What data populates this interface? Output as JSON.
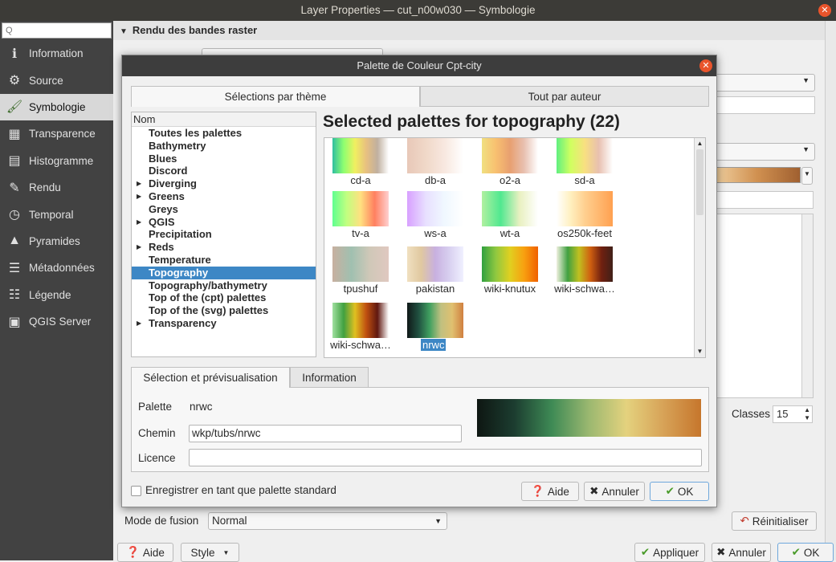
{
  "window": {
    "title": "Layer Properties — cut_n00w030 — Symbologie"
  },
  "sidebar": {
    "search_placeholder": "Q",
    "items": [
      {
        "label": "Information",
        "icon": "info-icon"
      },
      {
        "label": "Source",
        "icon": "source-icon"
      },
      {
        "label": "Symbologie",
        "icon": "brush-icon"
      },
      {
        "label": "Transparence",
        "icon": "transparency-icon"
      },
      {
        "label": "Histogramme",
        "icon": "histogram-icon"
      },
      {
        "label": "Rendu",
        "icon": "rendering-icon"
      },
      {
        "label": "Temporal",
        "icon": "clock-icon"
      },
      {
        "label": "Pyramides",
        "icon": "pyramid-icon"
      },
      {
        "label": "Métadonnées",
        "icon": "metadata-icon"
      },
      {
        "label": "Légende",
        "icon": "legend-icon"
      },
      {
        "label": "QGIS Server",
        "icon": "server-icon"
      }
    ]
  },
  "main": {
    "section_title": "Rendu des bandes raster",
    "classes_label": "Classes",
    "classes_value": "15",
    "blend_label": "Mode de fusion",
    "blend_value": "Normal",
    "reset_button": "Réinitialiser"
  },
  "footer": {
    "help": "Aide",
    "style": "Style",
    "apply": "Appliquer",
    "cancel": "Annuler",
    "ok": "OK"
  },
  "dialog": {
    "title": "Palette de Couleur Cpt-city",
    "tabs": [
      "Sélections par thème",
      "Tout par auteur"
    ],
    "tree_header": "Nom",
    "tree_items": [
      {
        "label": "Toutes les palettes",
        "expandable": false
      },
      {
        "label": "Bathymetry",
        "expandable": false
      },
      {
        "label": "Blues",
        "expandable": false
      },
      {
        "label": "Discord",
        "expandable": false
      },
      {
        "label": "Diverging",
        "expandable": true
      },
      {
        "label": "Greens",
        "expandable": true
      },
      {
        "label": "Greys",
        "expandable": false
      },
      {
        "label": "QGIS",
        "expandable": true
      },
      {
        "label": "Precipitation",
        "expandable": false
      },
      {
        "label": "Reds",
        "expandable": true
      },
      {
        "label": "Temperature",
        "expandable": false
      },
      {
        "label": "Topography",
        "expandable": false,
        "selected": true
      },
      {
        "label": "Topography/bathymetry",
        "expandable": false
      },
      {
        "label": "Top of the (cpt) palettes",
        "expandable": false
      },
      {
        "label": "Top of the (svg) palettes",
        "expandable": false
      },
      {
        "label": "Transparency",
        "expandable": true
      }
    ],
    "gallery_title": "Selected palettes for topography (22)",
    "palettes": [
      {
        "name": "cd-a",
        "colors": [
          "#2fbfa0",
          "#8fff70",
          "#f0f060",
          "#e8c080",
          "#c0b0a0",
          "#ffffff"
        ]
      },
      {
        "name": "db-a",
        "colors": [
          "#e8c8b8",
          "#f0d8c8",
          "#f8e8e0",
          "#ffffff"
        ]
      },
      {
        "name": "o2-a",
        "colors": [
          "#f0e080",
          "#f8c070",
          "#e8a070",
          "#e8c0b0",
          "#ffffff"
        ]
      },
      {
        "name": "sd-a",
        "colors": [
          "#60f080",
          "#d0ff60",
          "#f8e080",
          "#e8c0b0",
          "#ffffff"
        ]
      },
      {
        "name": "tv-a",
        "colors": [
          "#60ff90",
          "#c0ff80",
          "#ffe080",
          "#ff8060",
          "#ffd0d0"
        ]
      },
      {
        "name": "ws-a",
        "colors": [
          "#d8a0ff",
          "#e8e0ff",
          "#f0f8ff",
          "#ffffff"
        ]
      },
      {
        "name": "wt-a",
        "colors": [
          "#b0f0a0",
          "#50e890",
          "#e8f0c0",
          "#ffffff"
        ]
      },
      {
        "name": "os250k-feet",
        "colors": [
          "#ffffff",
          "#fff0c0",
          "#ffd090",
          "#ffb870",
          "#ffa050"
        ]
      },
      {
        "name": "tpushuf",
        "colors": [
          "#c8b0a0",
          "#a0c0b0",
          "#d0c8b8",
          "#e0c8c0"
        ]
      },
      {
        "name": "pakistan",
        "colors": [
          "#f0e0c0",
          "#e0c8a0",
          "#c8b0e0",
          "#d8d0f0",
          "#f0f0ff"
        ]
      },
      {
        "name": "wiki-knutux",
        "colors": [
          "#30a040",
          "#90c840",
          "#e0d020",
          "#f8a010",
          "#f06000"
        ]
      },
      {
        "name": "wiki-schwa…",
        "colors": [
          "#f0f0e0",
          "#40a040",
          "#c0c020",
          "#d06010",
          "#702010",
          "#402018"
        ]
      },
      {
        "name": "wiki-schwa…",
        "colors": [
          "#a0e0a0",
          "#40a040",
          "#e0c020",
          "#c05010",
          "#601810",
          "#ffffff"
        ]
      },
      {
        "name": "nrwc",
        "colors": [
          "#101818",
          "#205040",
          "#40a060",
          "#c0c080",
          "#e0c070",
          "#d08040"
        ],
        "selected": true
      }
    ],
    "subtabs": [
      "Sélection et prévisualisation",
      "Information"
    ],
    "palette_label": "Palette",
    "palette_value": "nrwc",
    "path_label": "Chemin",
    "path_value": "wkp/tubs/nrwc",
    "license_label": "Licence",
    "license_value": "",
    "preview_colors": [
      "#0e1612",
      "#1c3d30",
      "#3e8a55",
      "#9bb870",
      "#e4d27e",
      "#d7a257",
      "#c6762c"
    ],
    "save_checkbox": "Enregistrer en tant que palette standard",
    "help_button": "Aide",
    "cancel_button": "Annuler",
    "ok_button": "OK"
  }
}
